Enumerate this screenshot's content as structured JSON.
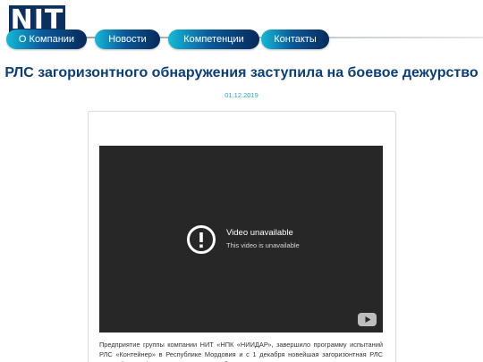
{
  "header": {
    "logo_text": "NIT",
    "nav": [
      {
        "label": "О Компании"
      },
      {
        "label": "Новости"
      },
      {
        "label": "Компетенции"
      },
      {
        "label": "Контакты"
      }
    ]
  },
  "article": {
    "title": "РЛС загоризонтного обнаружения заступила на боевое дежурство",
    "date": "01.12.2019",
    "video": {
      "title": "Video unavailable",
      "subtitle": "This video is unavailable",
      "status_icon": "alert-circle-icon",
      "brand_icon": "youtube-icon"
    },
    "body": "Предприятие группы компании НИТ «НПК «НИИДАР», завершило программу испытаний РЛС «Контейнер» в Республике Мордовия и с 1 декабря новейшая загоризонтная РЛС «Контейнер» официально заступила на боевое дежурство."
  },
  "colors": {
    "logo_bg": "#0b2f5e",
    "title": "#0b3e7d",
    "date": "#2aa7d8",
    "nav_gradient_start": "#15b9d8",
    "nav_gradient_end": "#062a5a",
    "video_bg": "#272727"
  }
}
